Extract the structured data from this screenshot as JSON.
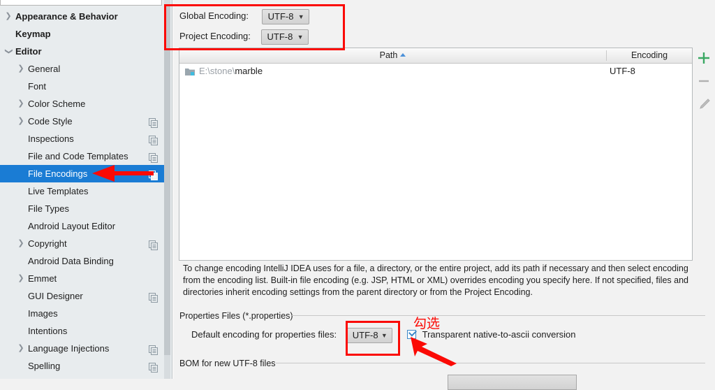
{
  "app": {
    "dialog": "Settings",
    "search_placeholder": ""
  },
  "sidebar": {
    "items": [
      {
        "label": "Appearance & Behavior",
        "level": 0,
        "twisty": "collapsed",
        "copy": false,
        "selected": false
      },
      {
        "label": "Keymap",
        "level": 0,
        "twisty": "none",
        "copy": false,
        "selected": false
      },
      {
        "label": "Editor",
        "level": 0,
        "twisty": "expanded",
        "copy": false,
        "selected": false
      },
      {
        "label": "General",
        "level": 1,
        "twisty": "collapsed",
        "copy": false,
        "selected": false
      },
      {
        "label": "Font",
        "level": 1,
        "twisty": "none",
        "copy": false,
        "selected": false
      },
      {
        "label": "Color Scheme",
        "level": 1,
        "twisty": "collapsed",
        "copy": false,
        "selected": false
      },
      {
        "label": "Code Style",
        "level": 1,
        "twisty": "collapsed",
        "copy": true,
        "selected": false
      },
      {
        "label": "Inspections",
        "level": 1,
        "twisty": "none",
        "copy": true,
        "selected": false
      },
      {
        "label": "File and Code Templates",
        "level": 1,
        "twisty": "none",
        "copy": true,
        "selected": false
      },
      {
        "label": "File Encodings",
        "level": 1,
        "twisty": "none",
        "copy": true,
        "selected": true
      },
      {
        "label": "Live Templates",
        "level": 1,
        "twisty": "none",
        "copy": false,
        "selected": false
      },
      {
        "label": "File Types",
        "level": 1,
        "twisty": "none",
        "copy": false,
        "selected": false
      },
      {
        "label": "Android Layout Editor",
        "level": 1,
        "twisty": "none",
        "copy": false,
        "selected": false
      },
      {
        "label": "Copyright",
        "level": 1,
        "twisty": "collapsed",
        "copy": true,
        "selected": false
      },
      {
        "label": "Android Data Binding",
        "level": 1,
        "twisty": "none",
        "copy": false,
        "selected": false
      },
      {
        "label": "Emmet",
        "level": 1,
        "twisty": "collapsed",
        "copy": false,
        "selected": false
      },
      {
        "label": "GUI Designer",
        "level": 1,
        "twisty": "none",
        "copy": true,
        "selected": false
      },
      {
        "label": "Images",
        "level": 1,
        "twisty": "none",
        "copy": false,
        "selected": false
      },
      {
        "label": "Intentions",
        "level": 1,
        "twisty": "none",
        "copy": false,
        "selected": false
      },
      {
        "label": "Language Injections",
        "level": 1,
        "twisty": "collapsed",
        "copy": true,
        "selected": false
      },
      {
        "label": "Spelling",
        "level": 1,
        "twisty": "none",
        "copy": true,
        "selected": false
      }
    ]
  },
  "encoding": {
    "global_label": "Global Encoding:",
    "global_value": "UTF-8",
    "project_label": "Project Encoding:",
    "project_value": "UTF-8"
  },
  "table": {
    "columns": {
      "path": "Path",
      "encoding": "Encoding"
    },
    "sort": "ascending",
    "rows": [
      {
        "path_dim": "E:\\stone\\",
        "path_strong": "marble",
        "encoding": "UTF-8",
        "icon": "folder-icon"
      }
    ],
    "tools": {
      "add": "+",
      "remove": "−",
      "edit": "pencil-icon"
    }
  },
  "description": "To change encoding IntelliJ IDEA uses for a file, a directory, or the entire project, add its path if necessary and then select encoding from the encoding list. Built-in file encoding (e.g. JSP, HTML or XML) overrides encoding you specify here. If not specified, files and directories inherit encoding settings from the parent directory or from the Project Encoding.",
  "properties_group": {
    "title": "Properties Files (*.properties)",
    "default_encoding_label": "Default encoding for properties files:",
    "default_encoding_value": "UTF-8",
    "transparent_checkbox_label": "Transparent native-to-ascii conversion",
    "transparent_checkbox_checked": true
  },
  "bom_group": {
    "title": "BOM for new UTF-8 files"
  },
  "annotations": {
    "chinese_note": "勾选",
    "highlight_color": "#fb0a05",
    "boxes": [
      "encoding-fields",
      "properties-default-encoding"
    ],
    "arrows": [
      "sidebar-file-encodings",
      "transparent-checkbox"
    ]
  },
  "colors": {
    "selection_blue": "#1a7cd4",
    "sidebar_bg": "#e8ecee",
    "panel_bg": "#f2f2f2",
    "annotation_red": "#fb0a05",
    "add_green": "#3aa863"
  }
}
